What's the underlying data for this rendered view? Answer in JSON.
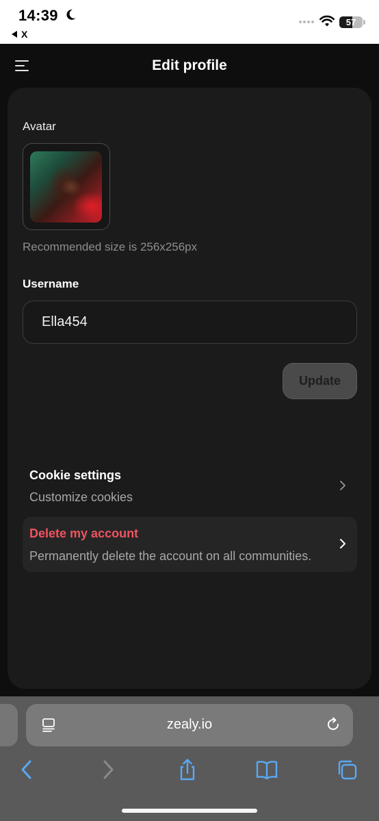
{
  "status_bar": {
    "time": "14:39",
    "back_app": "X",
    "battery_level": "57",
    "icons": [
      "moon-icon",
      "signal-icon",
      "wifi-icon",
      "battery-icon"
    ]
  },
  "header": {
    "title": "Edit profile",
    "menu_icon": "menu-icon"
  },
  "profile": {
    "avatar_label": "Avatar",
    "recommended_size": "Recommended size is 256x256px",
    "username_label": "Username",
    "username_value": "Ella454",
    "update_label": "Update"
  },
  "settings": {
    "cookie": {
      "title": "Cookie settings",
      "subtitle": "Customize cookies"
    },
    "delete": {
      "title": "Delete my account",
      "subtitle": "Permanently delete the account on all communities."
    }
  },
  "browser": {
    "url": "zealy.io",
    "toolbar_icons": [
      "back-icon",
      "forward-icon",
      "share-icon",
      "bookmarks-icon",
      "tabs-icon"
    ]
  },
  "colors": {
    "background": "#0e0e0e",
    "card": "#1b1b1b",
    "danger": "#f0545f",
    "safari_accent": "#5aa8f5"
  }
}
